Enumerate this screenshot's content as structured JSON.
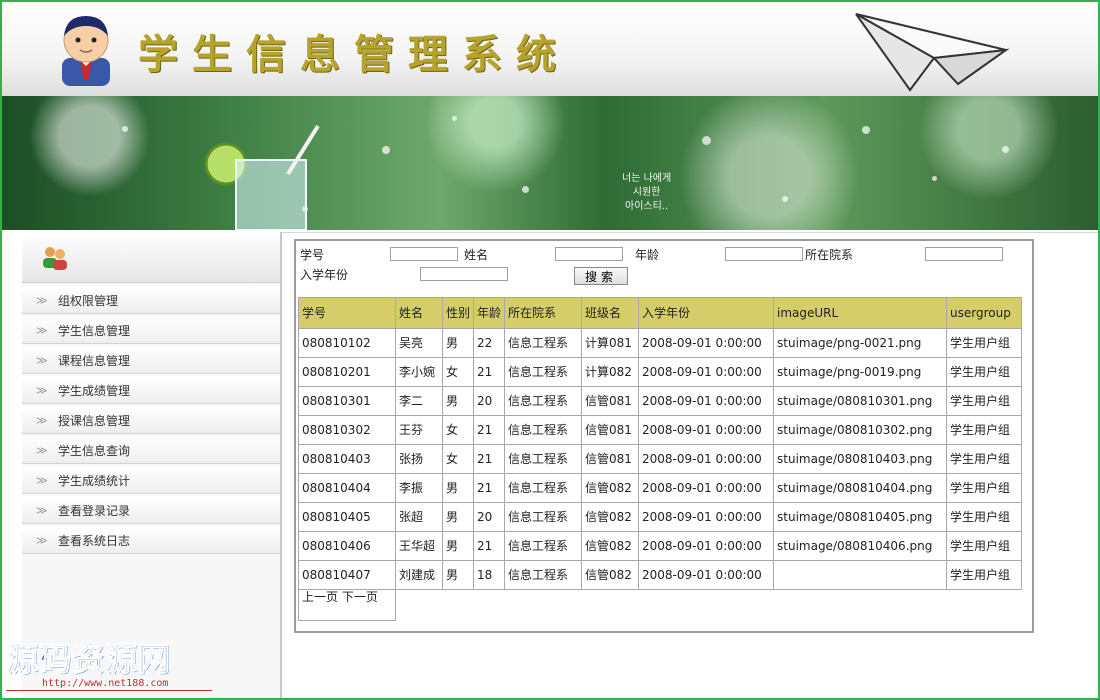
{
  "app": {
    "title": "学生信息管理系统"
  },
  "banner": {
    "lines": [
      "너는 나에게",
      "시원한",
      "아이스티.."
    ]
  },
  "sidebar": {
    "items": [
      {
        "label": "组权限管理"
      },
      {
        "label": "学生信息管理"
      },
      {
        "label": "课程信息管理"
      },
      {
        "label": "学生成绩管理"
      },
      {
        "label": "授课信息管理"
      },
      {
        "label": "学生信息查询"
      },
      {
        "label": "学生成绩统计"
      },
      {
        "label": "查看登录记录"
      },
      {
        "label": "查看系统日志"
      }
    ]
  },
  "search": {
    "student_id_label": "学号",
    "name_label": "姓名",
    "age_label": "年龄",
    "dept_label": "所在院系",
    "year_label": "入学年份",
    "student_id_value": "",
    "name_value": "",
    "age_value": "",
    "dept_value": "",
    "year_value": "",
    "search_button": "搜索"
  },
  "table": {
    "headers": [
      "学号",
      "姓名",
      "性别",
      "年龄",
      "所在院系",
      "班级名",
      "入学年份",
      "imageURL",
      "usergroup"
    ],
    "rows": [
      [
        "080810102",
        "吴亮",
        "男",
        "22",
        "信息工程系",
        "计算081",
        "2008-09-01 0:00:00",
        "stuimage/png-0021.png",
        "学生用户组"
      ],
      [
        "080810201",
        "李小婉",
        "女",
        "21",
        "信息工程系",
        "计算082",
        "2008-09-01 0:00:00",
        "stuimage/png-0019.png",
        "学生用户组"
      ],
      [
        "080810301",
        "李二",
        "男",
        "20",
        "信息工程系",
        "信管081",
        "2008-09-01 0:00:00",
        "stuimage/080810301.png",
        "学生用户组"
      ],
      [
        "080810302",
        "王芬",
        "女",
        "21",
        "信息工程系",
        "信管081",
        "2008-09-01 0:00:00",
        "stuimage/080810302.png",
        "学生用户组"
      ],
      [
        "080810403",
        "张扬",
        "女",
        "21",
        "信息工程系",
        "信管081",
        "2008-09-01 0:00:00",
        "stuimage/080810403.png",
        "学生用户组"
      ],
      [
        "080810404",
        "李振",
        "男",
        "21",
        "信息工程系",
        "信管082",
        "2008-09-01 0:00:00",
        "stuimage/080810404.png",
        "学生用户组"
      ],
      [
        "080810405",
        "张超",
        "男",
        "20",
        "信息工程系",
        "信管082",
        "2008-09-01 0:00:00",
        "stuimage/080810405.png",
        "学生用户组"
      ],
      [
        "080810406",
        "王华超",
        "男",
        "21",
        "信息工程系",
        "信管082",
        "2008-09-01 0:00:00",
        "stuimage/080810406.png",
        "学生用户组"
      ],
      [
        "080810407",
        "刘建成",
        "男",
        "18",
        "信息工程系",
        "信管082",
        "2008-09-01 0:00:00",
        "",
        "学生用户组"
      ]
    ],
    "pager": {
      "prev": "上一页",
      "next": "下一页"
    }
  },
  "watermark": {
    "text": "源码资源网",
    "url": "http://www.net188.com"
  },
  "colors": {
    "border_green": "#2fb34a",
    "header_row": "#d4cd6a",
    "title_gold": "#b6a32b"
  }
}
